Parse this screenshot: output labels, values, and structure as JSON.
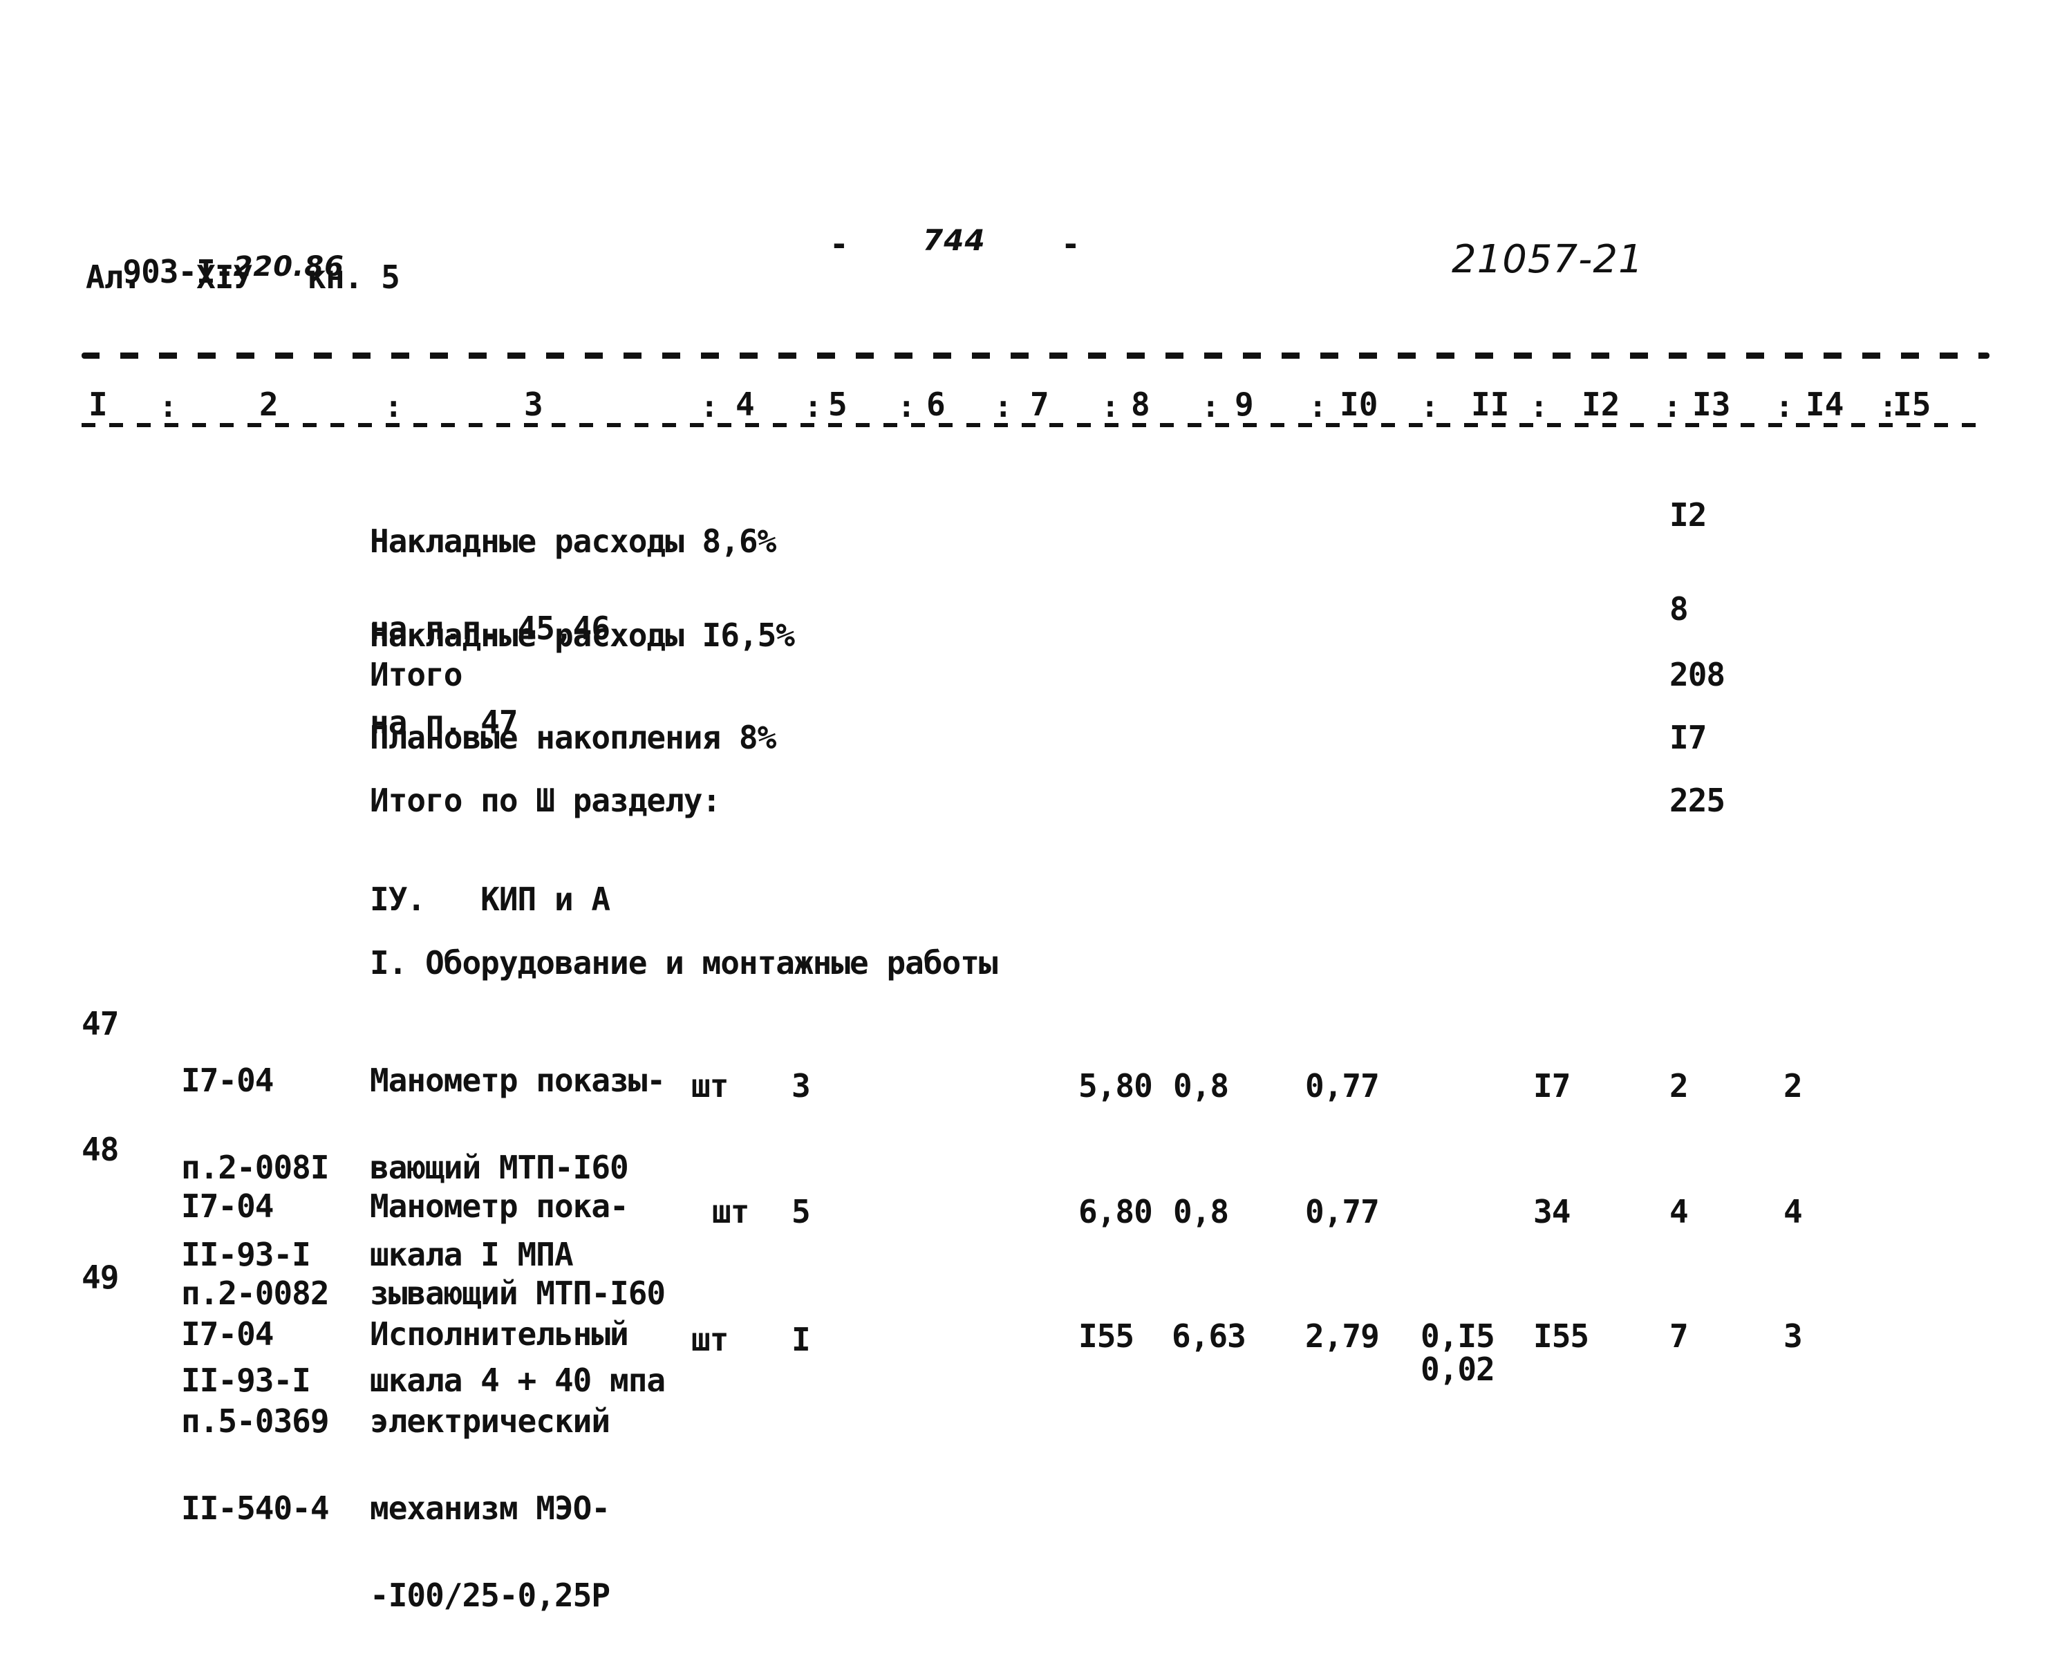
{
  "header": {
    "doc_code_prefix": "903-I-",
    "doc_code_handwritten": "220.86",
    "album_line": "Ал.   XIУ   кн. 5",
    "page_dash_left": "-",
    "page_number": "744",
    "page_dash_right": "-",
    "archive_number": "21057-21"
  },
  "columns": [
    "I",
    "2",
    "3",
    "4",
    "5",
    "6",
    "7",
    "8",
    "9",
    "I0",
    "II",
    "I2",
    "I3",
    "I4",
    "I5"
  ],
  "summary_lines": [
    {
      "label_lines": [
        "Накладные расходы 8,6%",
        "на п.п. 45,46"
      ],
      "col12": "I2"
    },
    {
      "label_lines": [
        "Накладные расходы I6,5%",
        "на п. 47"
      ],
      "col12": "8"
    },
    {
      "label_lines": [
        "Итого"
      ],
      "col12": "208"
    },
    {
      "label_lines": [
        "Плановые накопления 8%"
      ],
      "col12": "I7"
    },
    {
      "label_lines": [
        "Итого по Ш разделу:"
      ],
      "col12": "225"
    }
  ],
  "section": {
    "heading": "IУ.   КИП и А",
    "subheading": "I. Оборудование и монтажные работы"
  },
  "rows": [
    {
      "num": "47",
      "codes": [
        "I7-04",
        "п.2-008I",
        "II-93-I"
      ],
      "name_lines": [
        "Манометр показы-",
        "вающий МТП-I60",
        "шкала I МПА"
      ],
      "unit": "шт",
      "qty": "3",
      "c8": "5,80",
      "c9": "0,8",
      "c10": "0,77",
      "c11": "",
      "c11b": "",
      "c12": "I7",
      "c13": "2",
      "c14": "2"
    },
    {
      "num": "48",
      "codes": [
        "I7-04",
        "п.2-0082",
        "II-93-I"
      ],
      "name_lines": [
        "Манометр пока-",
        "зывающий МТП-I60",
        "шкала 4 + 40 мпа"
      ],
      "unit": "шт",
      "qty": "5",
      "c8": "6,80",
      "c9": "0,8",
      "c10": "0,77",
      "c11": "",
      "c11b": "",
      "c12": "34",
      "c13": "4",
      "c14": "4"
    },
    {
      "num": "49",
      "codes": [
        "I7-04",
        "п.5-0369",
        "II-540-4"
      ],
      "name_lines": [
        "Исполнительный",
        "электрический",
        "механизм МЭО-",
        "-I00/25-0,25Р"
      ],
      "unit": "шт",
      "qty": "I",
      "c8": "I55",
      "c9": "6,63",
      "c10": "2,79",
      "c11": "0,I5",
      "c11b": "0,02",
      "c12": "I55",
      "c13": "7",
      "c14": "3"
    }
  ]
}
